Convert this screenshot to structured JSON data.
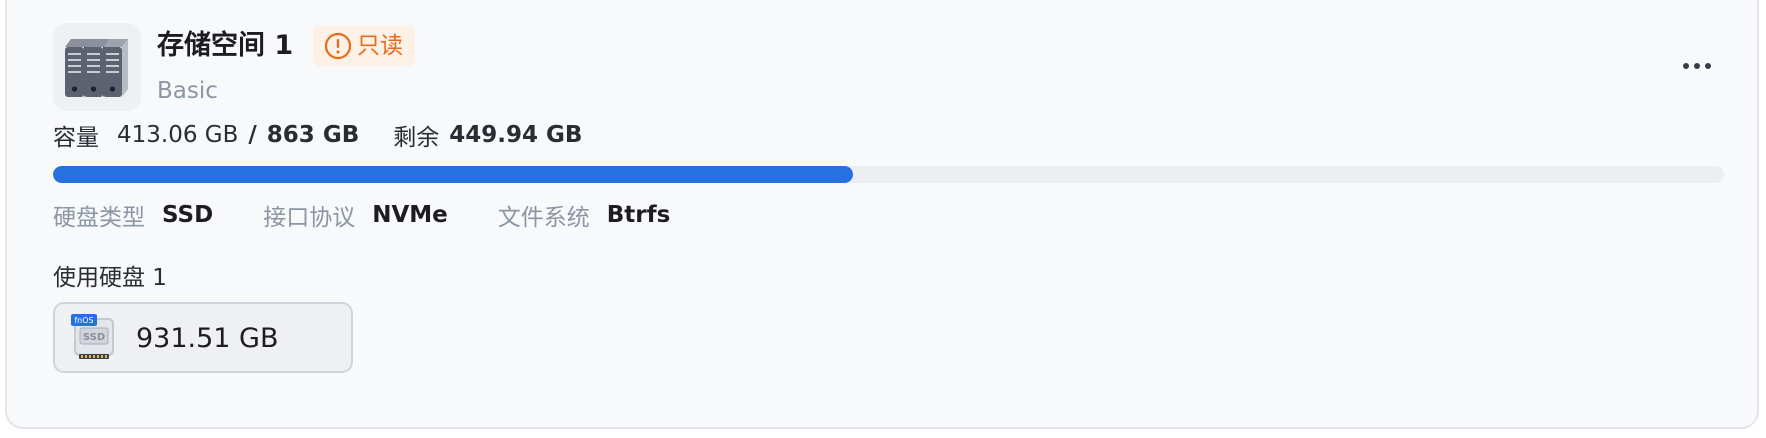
{
  "volume": {
    "name": "存储空间 1",
    "badge": "只读",
    "type": "Basic",
    "icon": "storage-server-icon"
  },
  "capacity": {
    "label": "容量",
    "used": "413.06 GB",
    "separator": "/",
    "total": "863 GB",
    "free_label": "剩余",
    "free": "449.94 GB",
    "used_fraction": 0.4786
  },
  "specs": [
    {
      "key": "硬盘类型",
      "value": "SSD"
    },
    {
      "key": "接口协议",
      "value": "NVMe"
    },
    {
      "key": "文件系统",
      "value": "Btrfs"
    }
  ],
  "disks": {
    "label": "使用硬盘 1",
    "items": [
      {
        "size": "931.51 GB",
        "icon_brand": "fnOS",
        "icon_type": "SSD"
      }
    ]
  },
  "colors": {
    "accent": "#2670df",
    "badge_text": "#ea6a1c",
    "badge_bg": "#fdf1e6",
    "muted_text": "#8c95a4"
  }
}
